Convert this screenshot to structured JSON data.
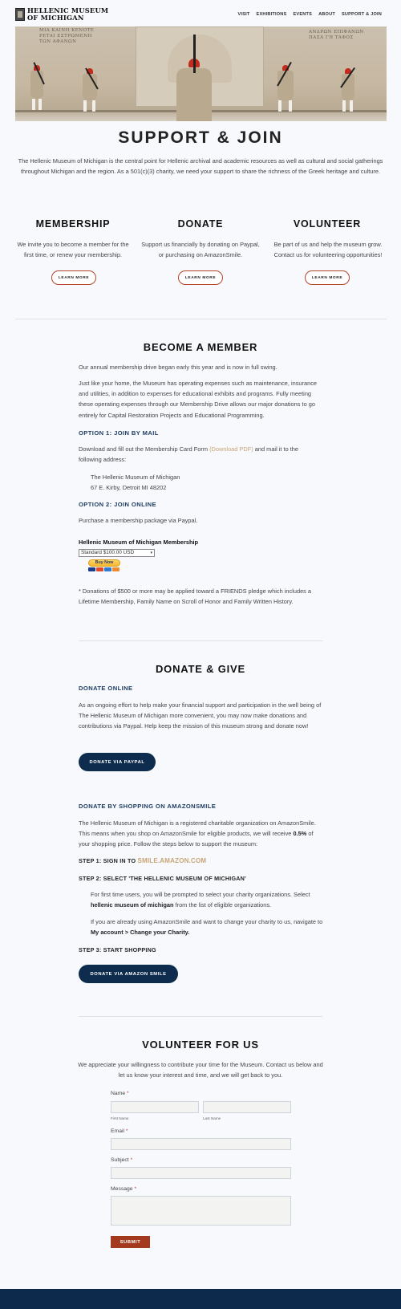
{
  "header": {
    "logo_line1": "HELLENIC MUSEUM",
    "logo_line2": "OF MICHIGAN",
    "nav": [
      "VISIT",
      "EXHIBITIONS",
      "EVENTS",
      "ABOUT",
      "SUPPORT & JOIN"
    ]
  },
  "hero": {
    "inscription_left": [
      "ΜΙΑ ΚΑΙΝΗ ΚΕΝΟΤΕ",
      "ΡΕΤΑΙ ΕΣΤΡΩΜΕΝΗ",
      "ΤΩΝ ΑΦΑΝΩΝ"
    ],
    "inscription_right": [
      "ΑΝΔΡΩΝ ΕΠΙΦΑΝΩΝ",
      "ΠΑΣΑ ΓΗ ΤΑΦΟΣ"
    ]
  },
  "page": {
    "title": "SUPPORT & JOIN",
    "intro": "The Hellenic Museum of Michigan is the central point for Hellenic archival and academic resources as well as cultural and social gatherings throughout Michigan and the region.  As a 501(c)(3) charity, we need your support to share the richness of the Greek heritage and culture."
  },
  "columns": [
    {
      "title": "MEMBERSHIP",
      "text": "We invite you to become a member for the first time, or renew your membership.",
      "button": "LEARN MORE"
    },
    {
      "title": "DONATE",
      "text": "Support us financially by donating on Paypal, or purchasing on AmazonSmile.",
      "button": "LEARN MORE"
    },
    {
      "title": "VOLUNTEER",
      "text": "Be part of us and help the museum grow. Contact us for volunteering opportunities!",
      "button": "LEARN MORE"
    }
  ],
  "member": {
    "title": "BECOME A MEMBER",
    "p1": "Our annual membership drive began early this year and is now in full swing.",
    "p2": "Just like your home, the Museum has operating expenses such as maintenance, insurance and utilities, in addition to expenses for educational exhibits and programs. Fully meeting these operating expenses through our Membership Drive allows our major donations to go entirely for Capital Restoration Projects and Educational Programming.",
    "opt1_title": "OPTION 1: JOIN BY MAIL",
    "opt1_text_a": "Download and fill out the Membership Card Form ",
    "opt1_link": "(Download PDF)",
    "opt1_text_b": " and mail it to the following address:",
    "address_line1": "The Hellenic Museum of Michigan",
    "address_line2": "67 E. Kirby, Detroit MI 48202",
    "opt2_title": "OPTION 2: JOIN ONLINE",
    "opt2_text": "Purchase a membership package via Paypal.",
    "paypal_title": "Hellenic Museum of Michigan Membership",
    "paypal_select": "Standard $100.00 USD",
    "paypal_button": "Buy Now",
    "note": "* Donations of $500 or more may be applied toward a FRIENDS pledge which includes a Lifetime Membership, Family Name on Scroll of Honor and Family Written History."
  },
  "donate": {
    "title": "DONATE & GIVE",
    "online_title": "DONATE ONLINE",
    "online_text": "As an ongoing effort to help make your financial support and participation in the well being of The Hellenic Museum of Michigan more convenient, you may now make donations and contributions via Paypal. Help keep the mission of this museum strong and donate now!",
    "paypal_button": "DONATE VIA PAYPAL",
    "amazon_title": "DONATE BY SHOPPING ON AMAZONSMILE",
    "amazon_text_a": "The Hellenic Museum of Michigan is a registered charitable organization on AmazonSmile. This means when you shop on AmazonSmile for eligible products, we will receive ",
    "amazon_pct": "0.5%",
    "amazon_text_b": " of your shopping price. Follow the steps below to support the museum:",
    "step1_label": "STEP 1: SIGN IN TO ",
    "step1_link": "SMILE.AMAZON.COM",
    "step2_label": "STEP 2: SELECT 'THE HELLENIC MUSEUM OF MICHIGAN'",
    "step2_p1_a": "For first time users, you will be prompted to select your charity organizations. Select ",
    "step2_p1_bold": "hellenic museum of michigan",
    "step2_p1_b": " from the list of eligible organizations.",
    "step2_p2_a": "If you are already using AmazonSmile and want to change your charity to us, navigate to ",
    "step2_p2_bold": "My account > Change your Charity.",
    "step3_label": "STEP 3: START SHOPPING",
    "amazon_button": "DONATE VIA AMAZON SMILE"
  },
  "volunteer": {
    "title": "VOLUNTEER FOR US",
    "text": "We appreciate your willingness to contribute your time for the Museum. Contact us below and let us know your interest and time, and we will get back to you.",
    "name_label": "Name",
    "first_name": "First Name",
    "last_name": "Last Name",
    "email_label": "Email",
    "subject_label": "Subject",
    "message_label": "Message",
    "required_mark": "*",
    "submit": "SUBMIT"
  }
}
